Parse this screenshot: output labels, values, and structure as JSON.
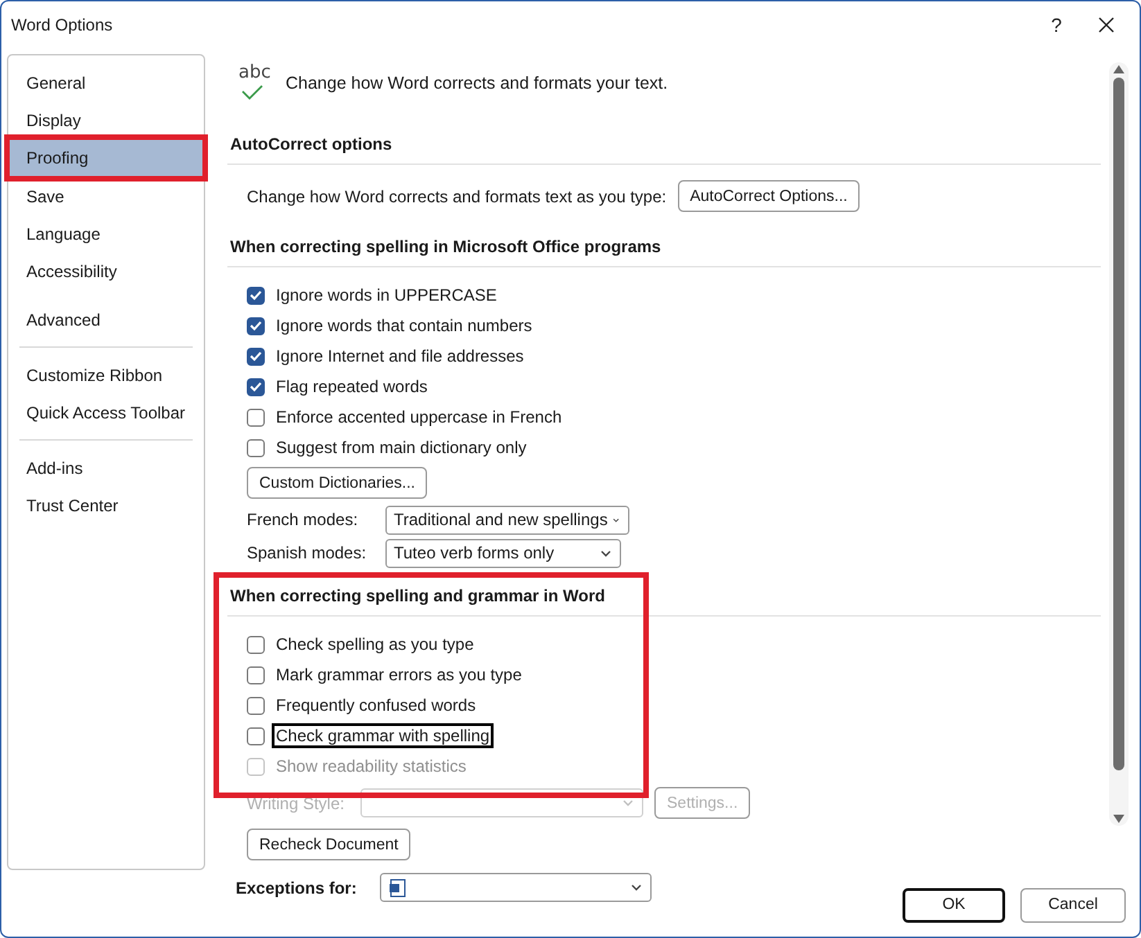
{
  "window": {
    "title": "Word Options",
    "help": "?"
  },
  "sidebar": {
    "items": [
      {
        "label": "General",
        "selected": false,
        "highlighted": false
      },
      {
        "label": "Display",
        "selected": false,
        "highlighted": false
      },
      {
        "label": "Proofing",
        "selected": true,
        "highlighted": true
      },
      {
        "label": "Save",
        "selected": false,
        "highlighted": false
      },
      {
        "label": "Language",
        "selected": false,
        "highlighted": false
      },
      {
        "label": "Accessibility",
        "selected": false,
        "highlighted": false
      },
      {
        "label": "Advanced",
        "selected": false,
        "highlighted": false
      },
      {
        "label": "Customize Ribbon",
        "selected": false,
        "highlighted": false
      },
      {
        "label": "Quick Access Toolbar",
        "selected": false,
        "highlighted": false
      },
      {
        "label": "Add-ins",
        "selected": false,
        "highlighted": false
      },
      {
        "label": "Trust Center",
        "selected": false,
        "highlighted": false
      }
    ]
  },
  "header": {
    "icon_text": "abc",
    "text": "Change how Word corrects and formats your text."
  },
  "sections": [
    {
      "title": "AutoCorrect options",
      "highlighted": false,
      "rows": [
        {
          "kind": "labeled_button",
          "label": "Change how Word corrects and formats text as you type:",
          "button": "AutoCorrect Options..."
        }
      ]
    },
    {
      "title": "When correcting spelling in Microsoft Office programs",
      "highlighted": false,
      "rows": [
        {
          "kind": "checkbox",
          "label": "Ignore words in UPPERCASE",
          "checked": true,
          "disabled": false,
          "focused": false
        },
        {
          "kind": "checkbox",
          "label": "Ignore words that contain numbers",
          "checked": true,
          "disabled": false,
          "focused": false
        },
        {
          "kind": "checkbox",
          "label": "Ignore Internet and file addresses",
          "checked": true,
          "disabled": false,
          "focused": false
        },
        {
          "kind": "checkbox",
          "label": "Flag repeated words",
          "checked": true,
          "disabled": false,
          "focused": false
        },
        {
          "kind": "checkbox",
          "label": "Enforce accented uppercase in French",
          "checked": false,
          "disabled": false,
          "focused": false
        },
        {
          "kind": "checkbox",
          "label": "Suggest from main dictionary only",
          "checked": false,
          "disabled": false,
          "focused": false
        },
        {
          "kind": "button",
          "button": "Custom Dictionaries...",
          "disabled": false
        },
        {
          "kind": "dropdown",
          "label": "French modes:",
          "value": "Traditional and new spellings",
          "disabled": false
        },
        {
          "kind": "dropdown",
          "label": "Spanish modes:",
          "value": "Tuteo verb forms only",
          "disabled": false
        }
      ]
    },
    {
      "title": "When correcting spelling and grammar in Word",
      "highlighted": true,
      "rows": [
        {
          "kind": "checkbox",
          "label": "Check spelling as you type",
          "checked": false,
          "disabled": false,
          "focused": false
        },
        {
          "kind": "checkbox",
          "label": "Mark grammar errors as you type",
          "checked": false,
          "disabled": false,
          "focused": false
        },
        {
          "kind": "checkbox",
          "label": "Frequently confused words",
          "checked": false,
          "disabled": false,
          "focused": false
        },
        {
          "kind": "checkbox",
          "label": "Check grammar with spelling",
          "checked": false,
          "disabled": false,
          "focused": true
        },
        {
          "kind": "checkbox",
          "label": "Show readability statistics",
          "checked": false,
          "disabled": true,
          "focused": false
        }
      ]
    }
  ],
  "after_rows": [
    {
      "kind": "dropdown_button",
      "label": "Writing Style:",
      "button": "Settings...",
      "disabled": true
    },
    {
      "kind": "button",
      "button": "Recheck Document",
      "disabled": false
    },
    {
      "kind": "doc_dropdown",
      "label": "Exceptions for:",
      "disabled": false
    }
  ],
  "buttons": [
    {
      "label": "OK",
      "default": true
    },
    {
      "label": "Cancel",
      "default": false
    }
  ]
}
